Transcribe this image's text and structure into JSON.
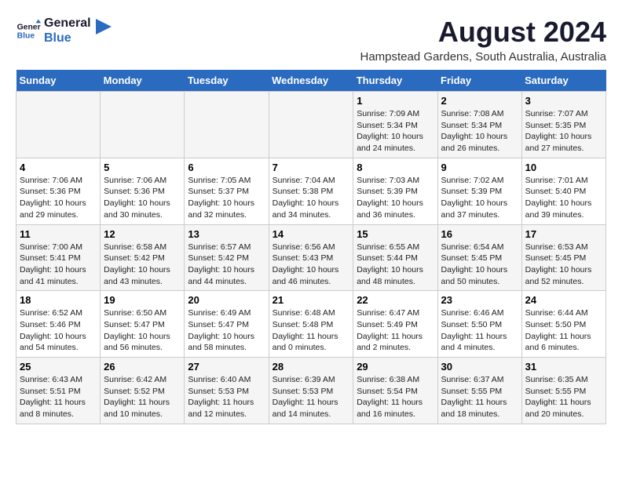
{
  "logo": {
    "line1": "General",
    "line2": "Blue"
  },
  "title": "August 2024",
  "subtitle": "Hampstead Gardens, South Australia, Australia",
  "days_header": [
    "Sunday",
    "Monday",
    "Tuesday",
    "Wednesday",
    "Thursday",
    "Friday",
    "Saturday"
  ],
  "weeks": [
    [
      {
        "day": "",
        "info": ""
      },
      {
        "day": "",
        "info": ""
      },
      {
        "day": "",
        "info": ""
      },
      {
        "day": "",
        "info": ""
      },
      {
        "day": "1",
        "info": "Sunrise: 7:09 AM\nSunset: 5:34 PM\nDaylight: 10 hours\nand 24 minutes."
      },
      {
        "day": "2",
        "info": "Sunrise: 7:08 AM\nSunset: 5:34 PM\nDaylight: 10 hours\nand 26 minutes."
      },
      {
        "day": "3",
        "info": "Sunrise: 7:07 AM\nSunset: 5:35 PM\nDaylight: 10 hours\nand 27 minutes."
      }
    ],
    [
      {
        "day": "4",
        "info": "Sunrise: 7:06 AM\nSunset: 5:36 PM\nDaylight: 10 hours\nand 29 minutes."
      },
      {
        "day": "5",
        "info": "Sunrise: 7:06 AM\nSunset: 5:36 PM\nDaylight: 10 hours\nand 30 minutes."
      },
      {
        "day": "6",
        "info": "Sunrise: 7:05 AM\nSunset: 5:37 PM\nDaylight: 10 hours\nand 32 minutes."
      },
      {
        "day": "7",
        "info": "Sunrise: 7:04 AM\nSunset: 5:38 PM\nDaylight: 10 hours\nand 34 minutes."
      },
      {
        "day": "8",
        "info": "Sunrise: 7:03 AM\nSunset: 5:39 PM\nDaylight: 10 hours\nand 36 minutes."
      },
      {
        "day": "9",
        "info": "Sunrise: 7:02 AM\nSunset: 5:39 PM\nDaylight: 10 hours\nand 37 minutes."
      },
      {
        "day": "10",
        "info": "Sunrise: 7:01 AM\nSunset: 5:40 PM\nDaylight: 10 hours\nand 39 minutes."
      }
    ],
    [
      {
        "day": "11",
        "info": "Sunrise: 7:00 AM\nSunset: 5:41 PM\nDaylight: 10 hours\nand 41 minutes."
      },
      {
        "day": "12",
        "info": "Sunrise: 6:58 AM\nSunset: 5:42 PM\nDaylight: 10 hours\nand 43 minutes."
      },
      {
        "day": "13",
        "info": "Sunrise: 6:57 AM\nSunset: 5:42 PM\nDaylight: 10 hours\nand 44 minutes."
      },
      {
        "day": "14",
        "info": "Sunrise: 6:56 AM\nSunset: 5:43 PM\nDaylight: 10 hours\nand 46 minutes."
      },
      {
        "day": "15",
        "info": "Sunrise: 6:55 AM\nSunset: 5:44 PM\nDaylight: 10 hours\nand 48 minutes."
      },
      {
        "day": "16",
        "info": "Sunrise: 6:54 AM\nSunset: 5:45 PM\nDaylight: 10 hours\nand 50 minutes."
      },
      {
        "day": "17",
        "info": "Sunrise: 6:53 AM\nSunset: 5:45 PM\nDaylight: 10 hours\nand 52 minutes."
      }
    ],
    [
      {
        "day": "18",
        "info": "Sunrise: 6:52 AM\nSunset: 5:46 PM\nDaylight: 10 hours\nand 54 minutes."
      },
      {
        "day": "19",
        "info": "Sunrise: 6:50 AM\nSunset: 5:47 PM\nDaylight: 10 hours\nand 56 minutes."
      },
      {
        "day": "20",
        "info": "Sunrise: 6:49 AM\nSunset: 5:47 PM\nDaylight: 10 hours\nand 58 minutes."
      },
      {
        "day": "21",
        "info": "Sunrise: 6:48 AM\nSunset: 5:48 PM\nDaylight: 11 hours\nand 0 minutes."
      },
      {
        "day": "22",
        "info": "Sunrise: 6:47 AM\nSunset: 5:49 PM\nDaylight: 11 hours\nand 2 minutes."
      },
      {
        "day": "23",
        "info": "Sunrise: 6:46 AM\nSunset: 5:50 PM\nDaylight: 11 hours\nand 4 minutes."
      },
      {
        "day": "24",
        "info": "Sunrise: 6:44 AM\nSunset: 5:50 PM\nDaylight: 11 hours\nand 6 minutes."
      }
    ],
    [
      {
        "day": "25",
        "info": "Sunrise: 6:43 AM\nSunset: 5:51 PM\nDaylight: 11 hours\nand 8 minutes."
      },
      {
        "day": "26",
        "info": "Sunrise: 6:42 AM\nSunset: 5:52 PM\nDaylight: 11 hours\nand 10 minutes."
      },
      {
        "day": "27",
        "info": "Sunrise: 6:40 AM\nSunset: 5:53 PM\nDaylight: 11 hours\nand 12 minutes."
      },
      {
        "day": "28",
        "info": "Sunrise: 6:39 AM\nSunset: 5:53 PM\nDaylight: 11 hours\nand 14 minutes."
      },
      {
        "day": "29",
        "info": "Sunrise: 6:38 AM\nSunset: 5:54 PM\nDaylight: 11 hours\nand 16 minutes."
      },
      {
        "day": "30",
        "info": "Sunrise: 6:37 AM\nSunset: 5:55 PM\nDaylight: 11 hours\nand 18 minutes."
      },
      {
        "day": "31",
        "info": "Sunrise: 6:35 AM\nSunset: 5:55 PM\nDaylight: 11 hours\nand 20 minutes."
      }
    ]
  ]
}
